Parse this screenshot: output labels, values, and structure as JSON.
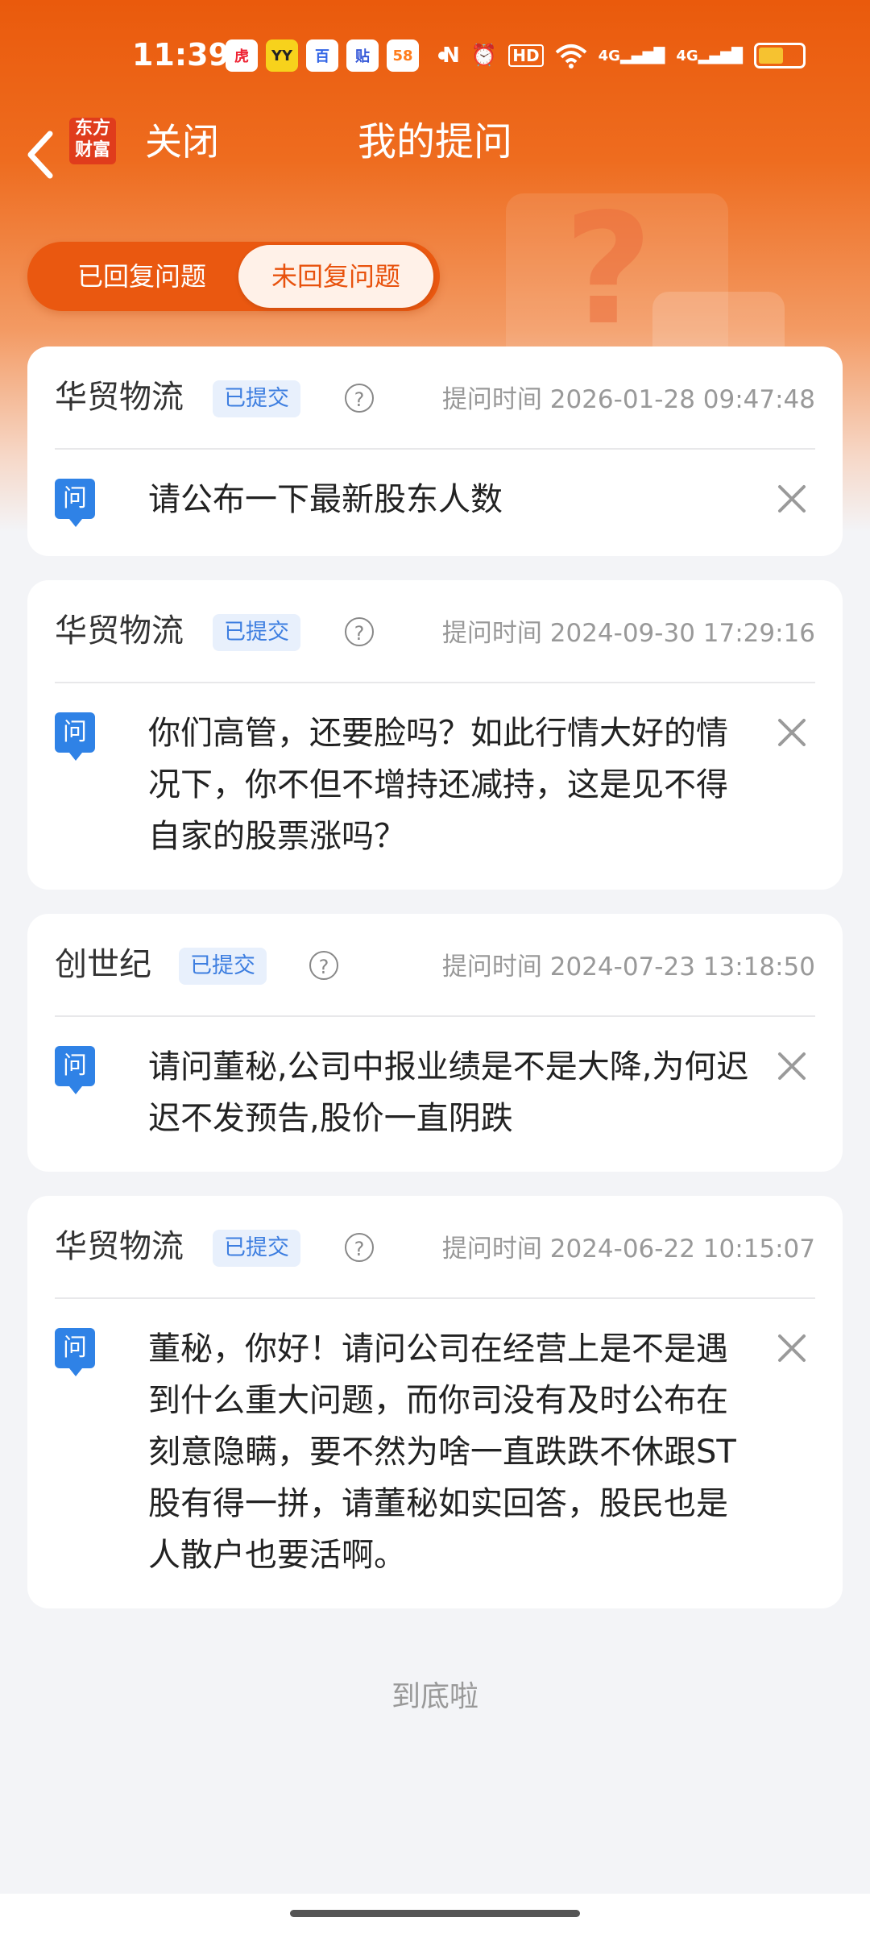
{
  "status_bar": {
    "time": "11:39",
    "app_icons": [
      "hupu-icon",
      "yy-icon",
      "baidu-icon",
      "tieba-icon",
      "58-icon"
    ],
    "system_icons": [
      "nfc-icon",
      "alarm-icon",
      "hd-icon",
      "wifi-icon",
      "4g-signal-icon",
      "4g-signal-icon",
      "battery-icon"
    ],
    "hd_label": "HD",
    "signal_label_1": "4G",
    "signal_label_2": "4G"
  },
  "nav": {
    "brand_logo_line1": "东方",
    "brand_logo_line2": "财富",
    "close_label": "关闭",
    "title": "我的提问"
  },
  "tabs": {
    "answered": "已回复问题",
    "unanswered": "未回复问题",
    "active": "unanswered"
  },
  "cards": [
    {
      "company": "华贸物流",
      "status": "已提交",
      "time": "提问时间 2026-01-28 09:47:48",
      "question": "请公布一下最新股东人数"
    },
    {
      "company": "华贸物流",
      "status": "已提交",
      "time": "提问时间 2024-09-30 17:29:16",
      "question": "你们高管，还要脸吗？如此行情大好的情况下，你不但不增持还减持，这是见不得自家的股票涨吗？"
    },
    {
      "company": "创世纪",
      "status": "已提交",
      "time": "提问时间 2024-07-23 13:18:50",
      "question": "请问董秘,公司中报业绩是不是大降,为何迟迟不发预告,股价一直阴跌"
    },
    {
      "company": "华贸物流",
      "status": "已提交",
      "time": "提问时间 2024-06-22 10:15:07",
      "question": "董秘，你好！请问公司在经营上是不是遇到什么重大问题，而你司没有及时公布在刻意隐瞒，要不然为啥一直跌跌不休跟ST股有得一拼，请董秘如实回答，股民也是人散户也要活啊。"
    }
  ],
  "question_icon_label": "问",
  "help_icon_label": "?",
  "end_text": "到底啦",
  "colors": {
    "brand_orange": "#ea5a0c",
    "badge_blue": "#3d7ee0",
    "question_icon_blue": "#2f82e6"
  }
}
